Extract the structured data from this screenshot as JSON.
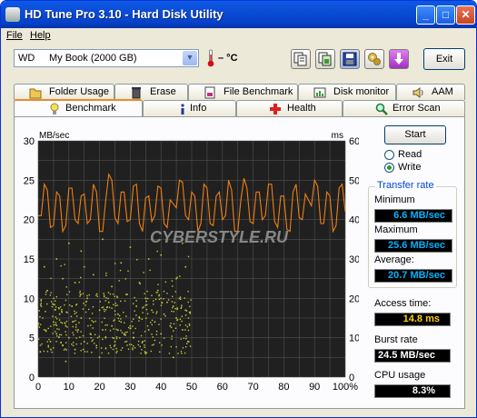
{
  "window": {
    "title": "HD Tune Pro 3.10 - Hard Disk Utility",
    "buttons": {
      "minimize": "_",
      "maximize": "□",
      "close": "✕"
    }
  },
  "menu": {
    "items": [
      {
        "label": "File"
      },
      {
        "label": "Help"
      }
    ]
  },
  "toolbar": {
    "drive_prefix": "WD",
    "drive_name": "My Book (2000 GB)",
    "temperature": "– °C",
    "icons": [
      "copy-text-icon",
      "copy-screenshot-icon",
      "save-icon",
      "options-icon",
      "download-icon"
    ],
    "exit_label": "Exit"
  },
  "tabs": {
    "row1": [
      {
        "label": "Folder Usage",
        "icon": "folder-icon"
      },
      {
        "label": "Erase",
        "icon": "trash-icon"
      },
      {
        "label": "File Benchmark",
        "icon": "file-benchmark-icon"
      },
      {
        "label": "Disk monitor",
        "icon": "disk-monitor-icon"
      },
      {
        "label": "AAM",
        "icon": "speaker-icon"
      }
    ],
    "row2": [
      {
        "label": "Benchmark",
        "icon": "bulb-icon",
        "active": true
      },
      {
        "label": "Info",
        "icon": "info-icon"
      },
      {
        "label": "Health",
        "icon": "health-cross-icon"
      },
      {
        "label": "Error Scan",
        "icon": "magnifier-icon"
      }
    ]
  },
  "controls": {
    "start_label": "Start",
    "modes": [
      {
        "label": "Read",
        "selected": false
      },
      {
        "label": "Write",
        "selected": true
      }
    ]
  },
  "transfer_rate": {
    "title": "Transfer rate",
    "minimum_label": "Minimum",
    "minimum": "6.6 MB/sec",
    "maximum_label": "Maximum",
    "maximum": "25.6 MB/sec",
    "average_label": "Average:",
    "average": "20.7 MB/sec"
  },
  "access_time": {
    "label": "Access time:",
    "value": "14.8 ms"
  },
  "burst_rate": {
    "label": "Burst rate",
    "value": "24.5 MB/sec"
  },
  "cpu_usage": {
    "label": "CPU usage",
    "value": "8.3%"
  },
  "colors": {
    "plot_bg": "#202020",
    "grid": "#505050",
    "transfer_line": "#f07f10",
    "access_points": "#c8c83a",
    "info_text": "#00b4ff",
    "access_text": "#ffd200"
  },
  "chart_data": {
    "type": "line",
    "watermark": "CYBERSTYLE.RU",
    "y_left": {
      "label": "MB/sec",
      "ticks": [
        0,
        5,
        10,
        15,
        20,
        25,
        30
      ],
      "range": [
        0,
        30
      ]
    },
    "y_right": {
      "label": "ms",
      "ticks": [
        0,
        10,
        20,
        30,
        40,
        50,
        60
      ],
      "range": [
        0,
        60
      ]
    },
    "x": {
      "ticks": [
        "0",
        "10",
        "20",
        "30",
        "40",
        "50",
        "60",
        "70",
        "80",
        "90",
        "100%"
      ],
      "range": [
        0,
        100
      ]
    },
    "series": [
      {
        "kind": "line",
        "axis": "left",
        "x": [
          0,
          2,
          4,
          6,
          8,
          10,
          12,
          14,
          16,
          18,
          20,
          22,
          24,
          26,
          28,
          30,
          32,
          34,
          36,
          38,
          40,
          42,
          44,
          46,
          48,
          50,
          52,
          54,
          56,
          58,
          60,
          62,
          64,
          66,
          68,
          70,
          72,
          74,
          76,
          78,
          80,
          82,
          84,
          86,
          88,
          90,
          92,
          94,
          96,
          98,
          100
        ],
        "values": [
          20.5,
          24.5,
          19,
          23.5,
          18.5,
          24,
          20,
          23,
          19.5,
          24.5,
          18.5,
          22.5,
          25,
          19.5,
          23.5,
          20,
          24.5,
          18.5,
          23,
          20.5,
          24,
          19,
          22,
          25,
          20.5,
          23.5,
          18.5,
          24.5,
          19.5,
          23,
          20,
          25,
          18.5,
          22.5,
          24,
          19.5,
          23.5,
          20.5,
          24.5,
          19,
          23,
          18.5,
          24.5,
          20,
          22.5,
          25,
          19.5,
          23.5,
          18.5,
          24,
          21
        ]
      },
      {
        "kind": "scatter",
        "axis": "right",
        "description_points": [
          [
            2,
            12
          ],
          [
            4,
            9
          ],
          [
            5,
            14
          ],
          [
            6,
            11
          ],
          [
            7,
            16
          ],
          [
            8,
            8
          ],
          [
            9,
            13
          ],
          [
            10,
            10
          ],
          [
            11,
            18
          ],
          [
            12,
            7
          ],
          [
            13,
            12
          ],
          [
            14,
            15
          ],
          [
            15,
            9
          ],
          [
            16,
            20
          ],
          [
            17,
            11
          ],
          [
            18,
            14
          ],
          [
            19,
            8
          ],
          [
            20,
            17
          ],
          [
            21,
            12
          ],
          [
            22,
            10
          ],
          [
            23,
            19
          ],
          [
            24,
            13
          ],
          [
            25,
            9
          ],
          [
            26,
            16
          ],
          [
            27,
            14
          ],
          [
            28,
            11
          ],
          [
            29,
            21
          ],
          [
            30,
            13
          ],
          [
            31,
            10
          ],
          [
            32,
            18
          ],
          [
            33,
            15
          ],
          [
            34,
            9
          ],
          [
            35,
            20
          ],
          [
            36,
            12
          ],
          [
            37,
            17
          ],
          [
            38,
            14
          ],
          [
            39,
            22
          ],
          [
            40,
            11
          ],
          [
            41,
            16
          ],
          [
            42,
            19
          ],
          [
            43,
            13
          ],
          [
            44,
            18
          ],
          [
            45,
            15
          ],
          [
            46,
            20
          ],
          [
            47,
            12
          ],
          [
            48,
            17
          ],
          [
            49,
            9
          ],
          [
            3,
            22
          ],
          [
            8,
            25
          ],
          [
            12,
            24
          ],
          [
            18,
            26
          ],
          [
            24,
            23
          ],
          [
            33,
            24
          ],
          [
            45,
            25
          ],
          [
            6,
            30
          ],
          [
            15,
            28
          ],
          [
            27,
            29
          ],
          [
            36,
            30
          ],
          [
            48,
            28
          ],
          [
            10,
            34
          ],
          [
            14,
            32
          ],
          [
            21,
            35
          ],
          [
            30,
            33
          ],
          [
            40,
            31
          ],
          [
            47,
            34
          ],
          [
            9,
            4
          ],
          [
            20,
            5
          ],
          [
            35,
            6
          ],
          [
            44,
            5
          ],
          [
            1,
            18
          ],
          [
            2,
            28
          ]
        ]
      }
    ]
  }
}
